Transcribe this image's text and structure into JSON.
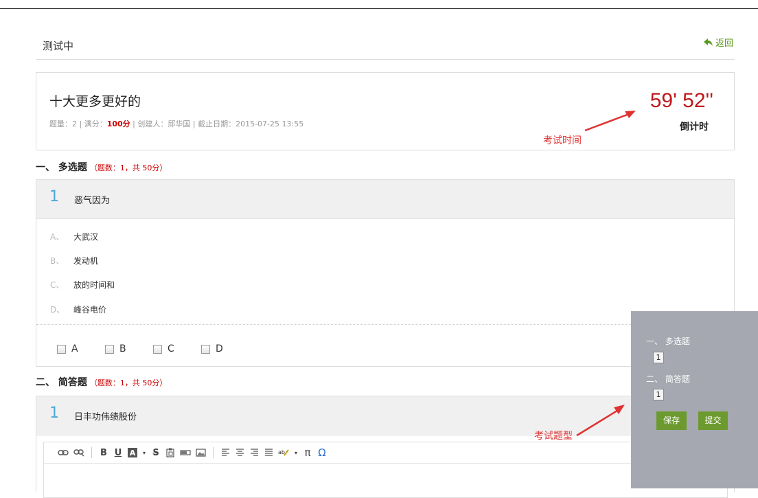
{
  "header": {
    "title": "测试中",
    "back_label": "返回"
  },
  "exam": {
    "name": "十大更多更好的",
    "meta_count_label": "题量：",
    "meta_count": "2",
    "meta_score_label": "满分：",
    "meta_score": "100分",
    "meta_creator_label": "创建人：",
    "meta_creator": "邱华国",
    "meta_deadline_label": "截止日期：",
    "meta_deadline": "2015-07-25 13:55",
    "timer": "59' 52''",
    "timer_label": "倒计时"
  },
  "annotations": {
    "time": "考试时间",
    "types": "考试题型"
  },
  "sections": [
    {
      "heading": "一、 多选题",
      "info": "（题数：1，共 50分）",
      "question": {
        "number": "1",
        "text": "恶气因为",
        "options": [
          {
            "letter": "A、",
            "text": "大武汉"
          },
          {
            "letter": "B、",
            "text": "发动机"
          },
          {
            "letter": "C、",
            "text": "放的时间和"
          },
          {
            "letter": "D、",
            "text": "峰谷电价"
          }
        ],
        "choices": [
          "A",
          "B",
          "C",
          "D"
        ]
      }
    },
    {
      "heading": "二、 简答题",
      "info": "（题数：1，共 50分）",
      "question": {
        "number": "1",
        "text": "日丰功伟绩股份"
      }
    }
  ],
  "toolbar_glyphs": {
    "bold": "B",
    "underline": "U",
    "bg": "A",
    "strike": "S",
    "pi": "π",
    "omega": "Ω"
  },
  "side_panel": {
    "sections": [
      {
        "label": "一、 多选题",
        "items": [
          "1"
        ]
      },
      {
        "label": "二、 简答题",
        "items": [
          "1"
        ]
      }
    ],
    "save_label": "保存",
    "submit_label": "提交"
  },
  "colors": {
    "accent_green": "#6d9a2f",
    "timer_red": "#c0171b",
    "number_blue": "#49a9d9",
    "annotation_red": "#e03232"
  }
}
